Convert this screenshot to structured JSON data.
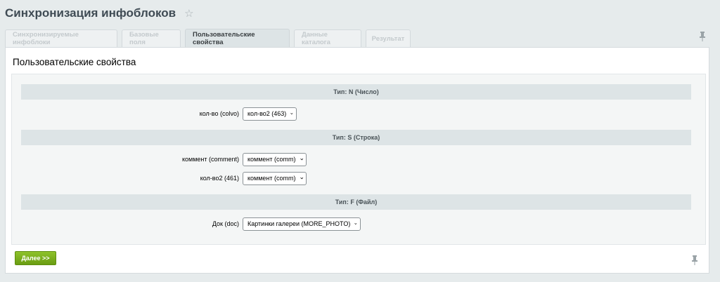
{
  "page": {
    "title": "Синхронизация инфоблоков"
  },
  "tabs": [
    {
      "label": "Синхронизируемые инфоблоки",
      "active": false
    },
    {
      "label": "Базовые поля",
      "active": false
    },
    {
      "label": "Пользовательские свойства",
      "active": true
    },
    {
      "label": "Данные каталога",
      "active": false
    },
    {
      "label": "Результат",
      "active": false
    }
  ],
  "panel": {
    "heading": "Пользовательские свойства",
    "sections": [
      {
        "title": "Тип: N (Число)",
        "rows": [
          {
            "label": "кол-во (colvo)",
            "value": "кол-во2 (463)"
          }
        ]
      },
      {
        "title": "Тип: S (Строка)",
        "rows": [
          {
            "label": "коммент (comment)",
            "value": "коммент (comm)"
          },
          {
            "label": "кол-во2 (461)",
            "value": "коммент (comm)"
          }
        ]
      },
      {
        "title": "Тип: F (Файл)",
        "rows": [
          {
            "label": "Док (doc)",
            "value": "Картинки галереи (MORE_PHOTO)"
          }
        ]
      }
    ],
    "next_label": "Далее >>"
  },
  "icons": {
    "star": "star-icon",
    "pin": "pin-icon",
    "chevron": "chevron-down-icon"
  },
  "colors": {
    "accent_button": "#7cb11d",
    "section_header_bg": "#dde4e6",
    "page_bg": "#e6ebec"
  }
}
